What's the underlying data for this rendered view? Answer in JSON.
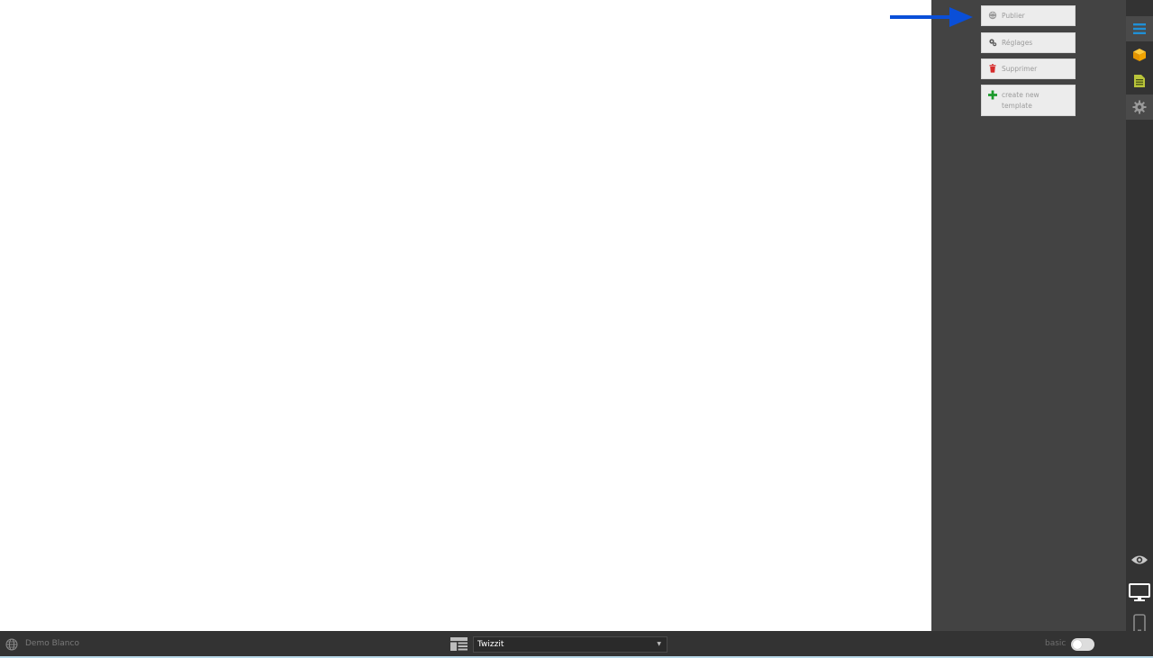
{
  "actions": {
    "publish_label": "Publier",
    "settings_label": "Réglages",
    "delete_label": "Supprimer",
    "create_template_label_line1": "create new",
    "create_template_label_line2": "template"
  },
  "rail": {
    "icons": [
      "menu-icon",
      "cube-icon",
      "page-icon",
      "gear-icon",
      "eye-icon",
      "desktop-icon",
      "mobile-icon"
    ]
  },
  "bottombar": {
    "site_name": "Demo Blanco",
    "template_selected": "Twizzit",
    "mode_label": "basic",
    "mode_toggle_on": false
  },
  "colors": {
    "panel": "#434343",
    "rail": "#333333",
    "accent_blue": "#1f8fd6",
    "arrow": "#0a4fd8",
    "delete_red": "#d62b2b",
    "create_green": "#1c9a2c",
    "cube_orange": "#f2a400",
    "page_green": "#b9c43a"
  }
}
